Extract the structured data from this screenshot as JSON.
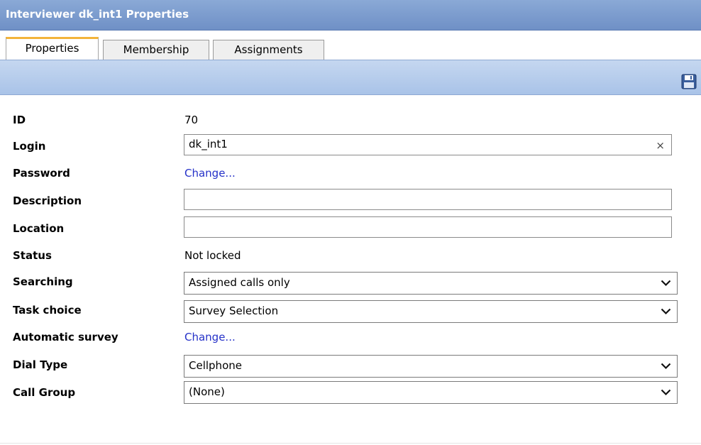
{
  "window": {
    "title": "Interviewer dk_int1 Properties"
  },
  "tabs": [
    {
      "label": "Properties",
      "active": true
    },
    {
      "label": "Membership",
      "active": false
    },
    {
      "label": "Assignments",
      "active": false
    }
  ],
  "toolbar": {
    "save_icon": "save-icon"
  },
  "form": {
    "id": {
      "label": "ID",
      "value": "70"
    },
    "login": {
      "label": "Login",
      "value": "dk_int1",
      "clear": "×"
    },
    "password": {
      "label": "Password",
      "link": "Change..."
    },
    "description": {
      "label": "Description",
      "value": ""
    },
    "location": {
      "label": "Location",
      "value": ""
    },
    "status": {
      "label": "Status",
      "value": "Not locked"
    },
    "searching": {
      "label": "Searching",
      "value": "Assigned calls only"
    },
    "task_choice": {
      "label": "Task choice",
      "value": "Survey Selection"
    },
    "automatic_survey": {
      "label": "Automatic survey",
      "link": "Change..."
    },
    "dial_type": {
      "label": "Dial Type",
      "value": "Cellphone"
    },
    "call_group": {
      "label": "Call Group",
      "value": "(None)"
    }
  }
}
